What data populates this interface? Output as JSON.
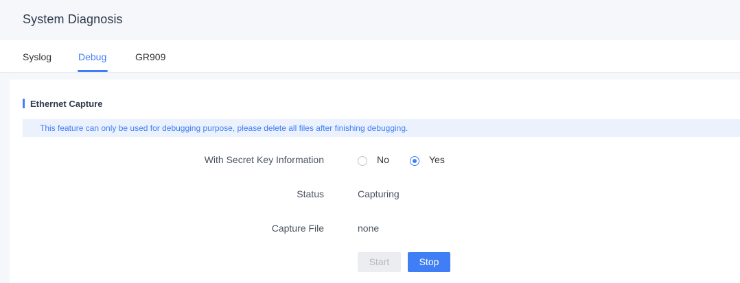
{
  "header": {
    "title": "System Diagnosis"
  },
  "tabs": [
    {
      "label": "Syslog",
      "active": false
    },
    {
      "label": "Debug",
      "active": true
    },
    {
      "label": "GR909",
      "active": false
    }
  ],
  "section": {
    "title": "Ethernet Capture",
    "notice": "This feature can only be used for debugging purpose, please delete all files after finishing debugging."
  },
  "form": {
    "secret_key": {
      "label": "With Secret Key Information",
      "options": [
        {
          "label": "No",
          "checked": false
        },
        {
          "label": "Yes",
          "checked": true
        }
      ]
    },
    "status": {
      "label": "Status",
      "value": "Capturing"
    },
    "capture_file": {
      "label": "Capture File",
      "value": "none"
    }
  },
  "buttons": {
    "start": {
      "label": "Start",
      "disabled": true
    },
    "stop": {
      "label": "Stop",
      "disabled": false
    }
  },
  "colors": {
    "accent": "#3f7ef5",
    "notice_bg": "#ebf2fe",
    "page_bg": "#f5f7fa"
  }
}
